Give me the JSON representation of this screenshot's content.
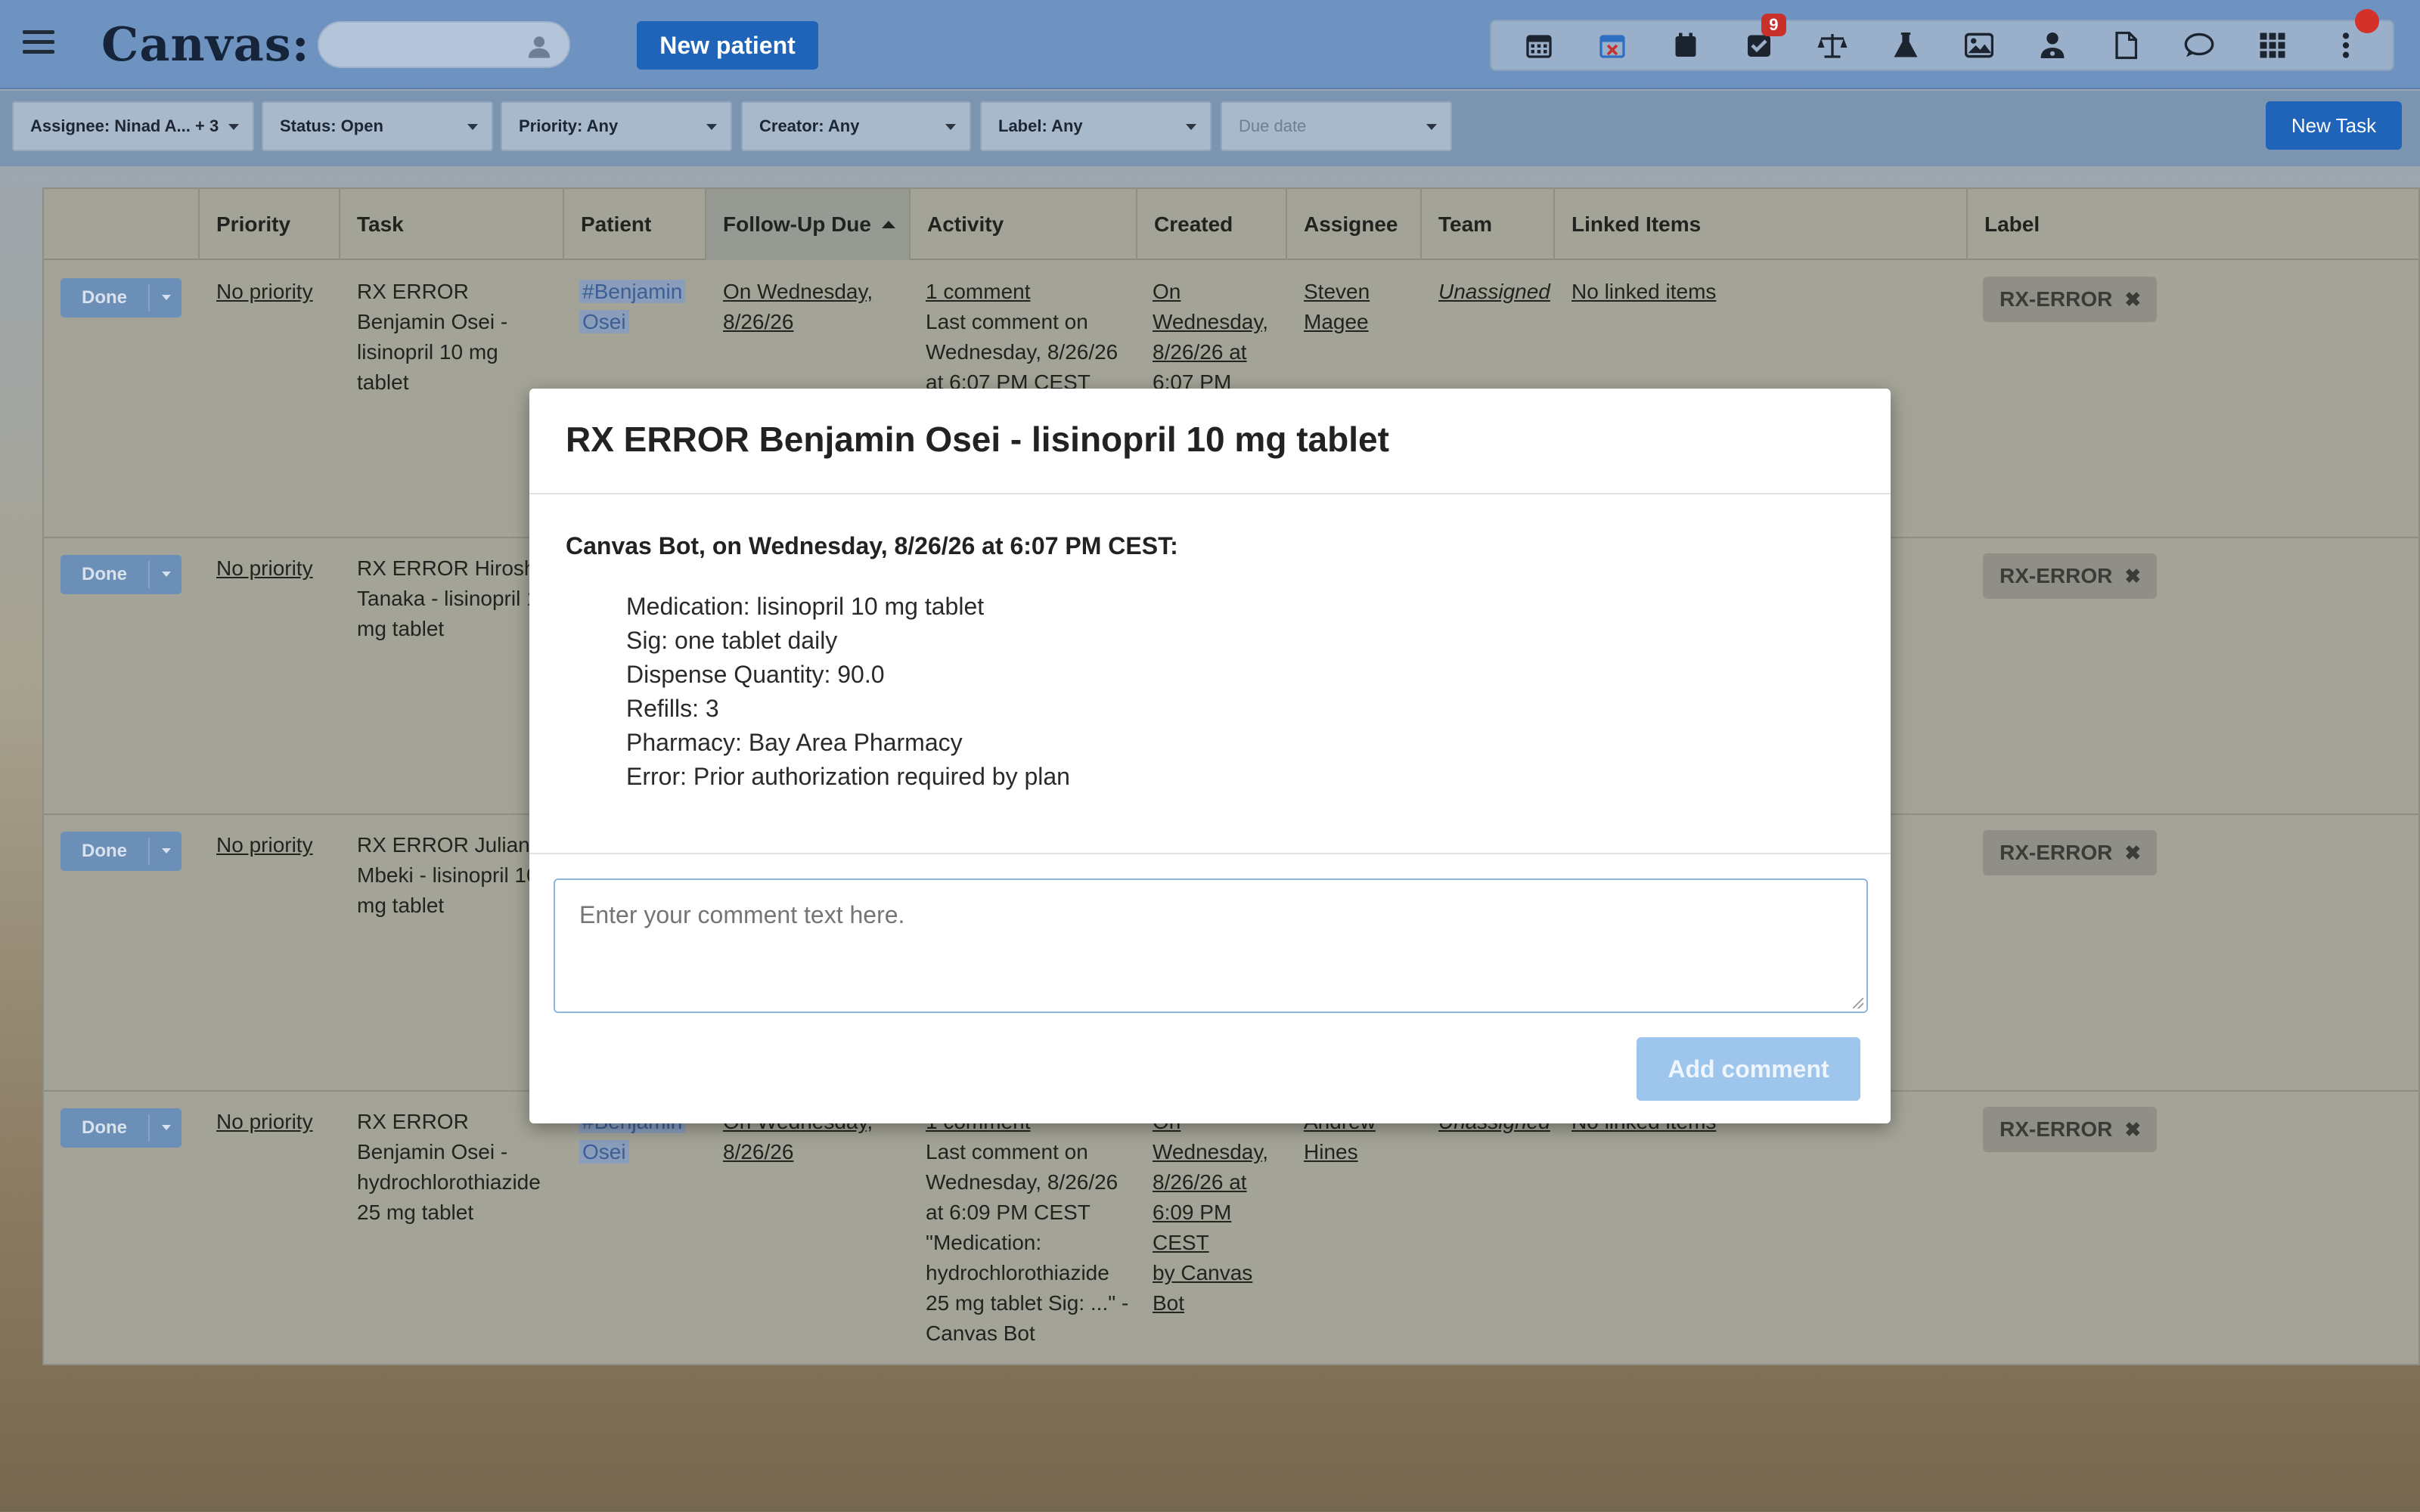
{
  "header": {
    "app_name": "Canvas:",
    "search_placeholder": "",
    "new_patient_label": "New patient",
    "tasks_badge": "9"
  },
  "filters": {
    "assignee": "Assignee: Ninad A... + 3",
    "status": "Status: Open",
    "priority": "Priority: Any",
    "creator": "Creator: Any",
    "label": "Label: Any",
    "due_date": "Due date",
    "new_task_label": "New Task"
  },
  "table": {
    "columns": [
      "Priority",
      "Task",
      "Patient",
      "Follow-Up Due",
      "Activity",
      "Created",
      "Assignee",
      "Team",
      "Linked Items",
      "Label"
    ],
    "rows": [
      {
        "done": "Done",
        "priority": "No priority",
        "task": [
          "RX ERROR",
          "Benjamin Osei -",
          "lisinopril 10 mg",
          "tablet"
        ],
        "patient": [
          "#Benjamin",
          "Osei"
        ],
        "followup": [
          "On Wednesday,",
          "8/26/26"
        ],
        "activity_link": "1 comment",
        "activity": [
          "Last comment on",
          "Wednesday, 8/26/26",
          "at 6:07 PM CEST"
        ],
        "created": [
          "On",
          "Wednesday,",
          "8/26/26 at",
          "6:07 PM"
        ],
        "assignee": [
          "Steven",
          "Magee"
        ],
        "team": "Unassigned",
        "linked": "No linked items",
        "label": "RX-ERROR"
      },
      {
        "done": "Done",
        "priority": "No priority",
        "task": [
          "RX ERROR Hiroshi",
          "Tanaka - lisinopril 1",
          "mg tablet"
        ],
        "label": "RX-ERROR"
      },
      {
        "done": "Done",
        "priority": "No priority",
        "task": [
          "RX ERROR Julian",
          "Mbeki - lisinopril 10",
          "mg tablet"
        ],
        "label": "RX-ERROR"
      },
      {
        "done": "Done",
        "priority": "No priority",
        "task": [
          "RX ERROR",
          "Benjamin Osei -",
          "hydrochlorothiazide",
          "25 mg tablet"
        ],
        "patient": [
          "#Benjamin",
          "Osei"
        ],
        "followup": [
          "On Wednesday,",
          "8/26/26"
        ],
        "activity_link": "1 comment",
        "activity": [
          "Last comment on",
          "Wednesday, 8/26/26",
          "at 6:09 PM CEST",
          "\"Medication:",
          "hydrochlorothiazide",
          "25 mg tablet Sig: ...\" -",
          "Canvas Bot"
        ],
        "created": [
          "On",
          "Wednesday,",
          "8/26/26 at",
          "6:09 PM",
          "CEST",
          "by Canvas",
          "Bot"
        ],
        "assignee": [
          "Andrew",
          "Hines"
        ],
        "team": "Unassigned",
        "linked": "No linked items",
        "label": "RX-ERROR"
      }
    ]
  },
  "modal": {
    "title": "RX ERROR Benjamin Osei - lisinopril 10 mg tablet",
    "comment_author": "Canvas Bot, on Wednesday, 8/26/26 at 6:07 PM CEST:",
    "details": [
      "Medication: lisinopril 10 mg tablet",
      "Sig: one tablet daily",
      "Dispense Quantity: 90.0",
      "Refills: 3",
      "Pharmacy: Bay Area Pharmacy",
      "Error: Prior authorization required by plan"
    ],
    "comment_placeholder": "Enter your comment text here.",
    "add_comment_label": "Add comment"
  },
  "colors": {
    "primary": "#1f64b8",
    "badge": "#c9302c",
    "add_comment_disabled": "#9ec6ec"
  },
  "icons": [
    "menu-icon",
    "person-icon",
    "calendar-icon",
    "calendar-cancel-icon",
    "calendar-solid-icon",
    "tasks-check-icon",
    "scale-icon",
    "flask-icon",
    "image-icon",
    "doctor-icon",
    "document-icon",
    "chat-icon",
    "grid-icon",
    "more-vertical-icon",
    "remove-x-icon"
  ]
}
